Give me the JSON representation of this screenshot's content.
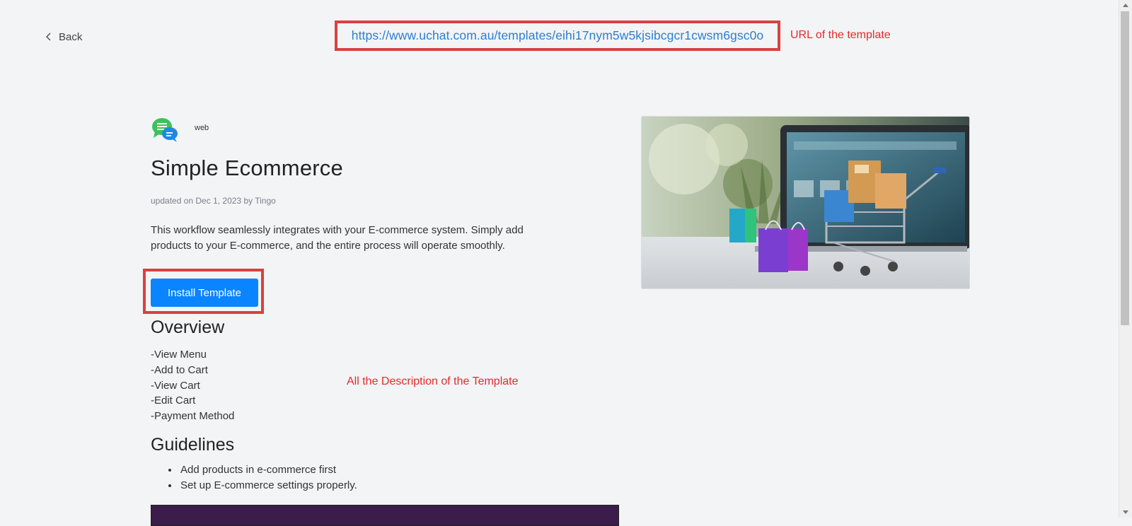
{
  "nav": {
    "back_label": "Back"
  },
  "template_url": "https://www.uchat.com.au/templates/eihi17nym5w5kjsibcgcr1cwsm6gsc0o",
  "annotations": {
    "url_note": "URL of the template",
    "description_note": "All the Description of the Template"
  },
  "template": {
    "platform": "web",
    "title": "Simple Ecommerce",
    "meta": "updated on Dec 1, 2023 by Tingo",
    "description": "This workflow seamlessly integrates with your E-commerce system. Simply add products to your E-commerce, and the entire process will operate smoothly.",
    "install_label": "Install Template"
  },
  "overview": {
    "heading": "Overview",
    "items": [
      "-View Menu",
      "-Add to Cart",
      "-View Cart",
      "-Edit Cart",
      "-Payment Method"
    ]
  },
  "guidelines": {
    "heading": "Guidelines",
    "items": [
      "Add products in e-commerce first",
      "Set up E-commerce settings properly."
    ]
  },
  "colors": {
    "accent": "#0a84ff",
    "link": "#2b7fd1",
    "annotation": "#e32b2b",
    "highlight_box": "#d9413f"
  },
  "icons": [
    "chevron-left-icon",
    "chat-bubbles-icon"
  ]
}
